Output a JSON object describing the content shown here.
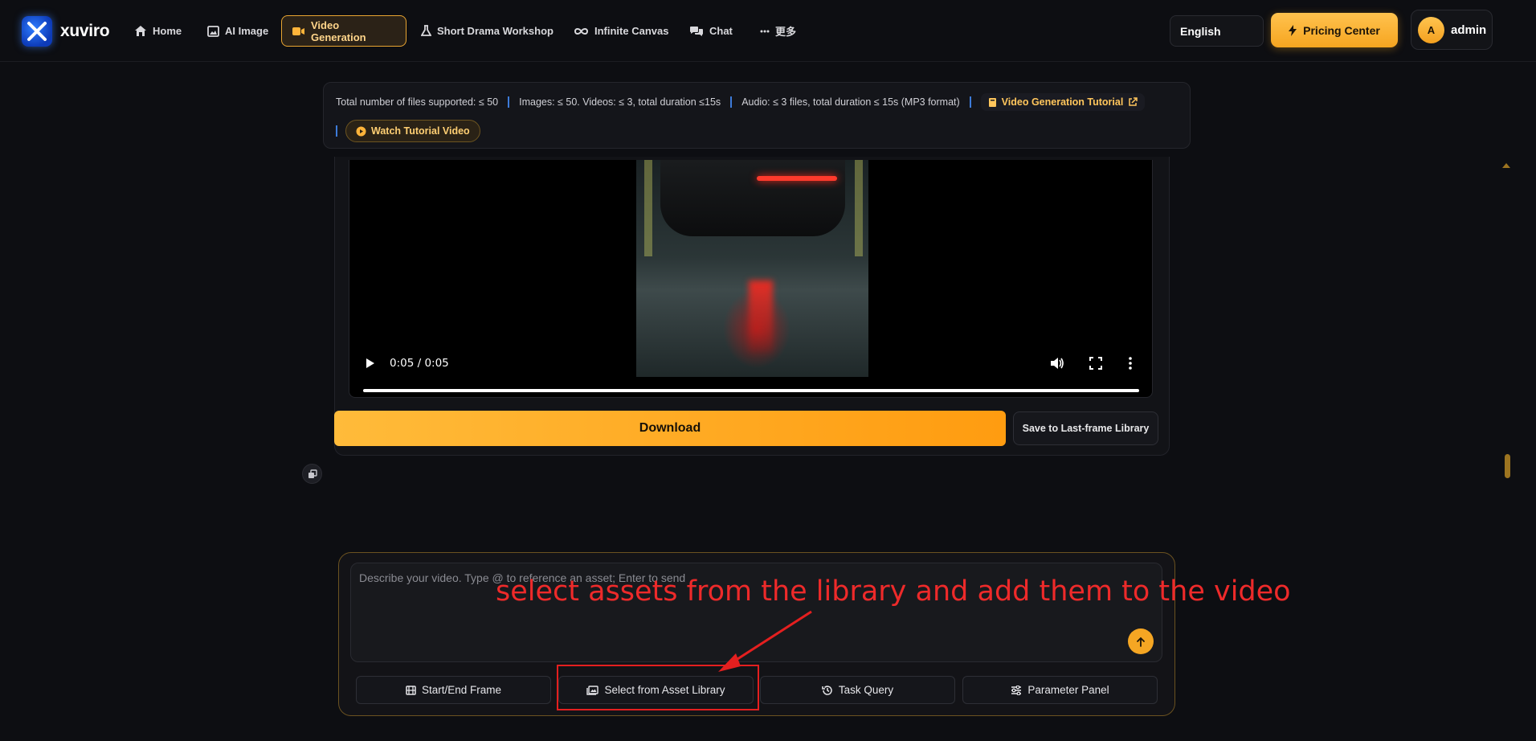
{
  "app": {
    "name": "xuviro"
  },
  "nav": {
    "items": [
      {
        "label": "Home",
        "icon": "home-icon"
      },
      {
        "label": "AI Image",
        "icon": "image-icon"
      },
      {
        "label": "Video Generation",
        "icon": "video-icon",
        "active": true
      },
      {
        "label": "Short Drama Workshop",
        "icon": "flask-icon"
      },
      {
        "label": "Infinite Canvas",
        "icon": "infinity-icon"
      },
      {
        "label": "Chat",
        "icon": "chat-icon"
      },
      {
        "label": "更多",
        "icon": "more-dots-icon"
      }
    ],
    "language": "English",
    "pricing_label": "Pricing Center",
    "user": {
      "initial": "A",
      "name": "admin"
    }
  },
  "info": {
    "files_total": "Total number of files supported: ≤ 50",
    "images_videos": "Images: ≤ 50. Videos: ≤ 3, total duration ≤15s",
    "audio": "Audio: ≤ 3 files, total duration ≤ 15s (MP3 format)",
    "tutorial_link": "Video Generation Tutorial",
    "watch_button": "Watch Tutorial Video"
  },
  "player": {
    "time": "0:05 / 0:05",
    "progress_fraction": 1.0
  },
  "result": {
    "download_label": "Download",
    "save_label": "Save to Last-frame Library"
  },
  "composer": {
    "placeholder": "Describe your video. Type @ to reference an asset; Enter to send",
    "tools": [
      {
        "label": "Start/End Frame",
        "icon": "film-icon"
      },
      {
        "label": "Select from Asset Library",
        "icon": "images-icon"
      },
      {
        "label": "Task Query",
        "icon": "history-icon"
      },
      {
        "label": "Parameter Panel",
        "icon": "sliders-icon"
      }
    ]
  },
  "annotation": {
    "text": "select assets from the library and add them to the video",
    "color": "#ee2a2a"
  },
  "colors": {
    "accent": "#f5a623",
    "background": "#0d0e12",
    "separator": "#3d7bd9"
  }
}
